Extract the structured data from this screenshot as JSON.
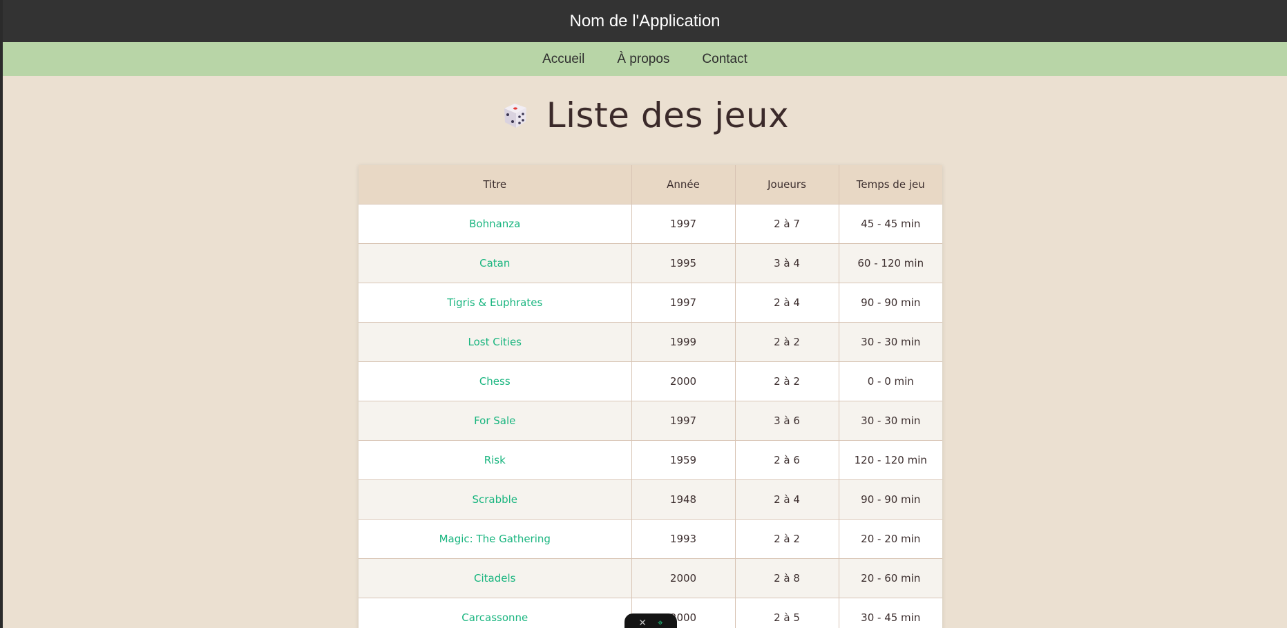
{
  "header": {
    "title": "Nom de l'Application"
  },
  "nav": {
    "items": [
      "Accueil",
      "À propos",
      "Contact"
    ]
  },
  "main": {
    "title": "Liste des jeux",
    "title_icon": "dice-icon"
  },
  "table": {
    "columns": [
      "Titre",
      "Année",
      "Joueurs",
      "Temps de jeu"
    ],
    "rows": [
      {
        "title": "Bohnanza",
        "year": "1997",
        "players": "2 à 7",
        "time": "45 - 45 min"
      },
      {
        "title": "Catan",
        "year": "1995",
        "players": "3 à 4",
        "time": "60 - 120 min"
      },
      {
        "title": "Tigris & Euphrates",
        "year": "1997",
        "players": "2 à 4",
        "time": "90 - 90 min"
      },
      {
        "title": "Lost Cities",
        "year": "1999",
        "players": "2 à 2",
        "time": "30 - 30 min"
      },
      {
        "title": "Chess",
        "year": "2000",
        "players": "2 à 2",
        "time": "0 - 0 min"
      },
      {
        "title": "For Sale",
        "year": "1997",
        "players": "3 à 6",
        "time": "30 - 30 min"
      },
      {
        "title": "Risk",
        "year": "1959",
        "players": "2 à 6",
        "time": "120 - 120 min"
      },
      {
        "title": "Scrabble",
        "year": "1948",
        "players": "2 à 4",
        "time": "90 - 90 min"
      },
      {
        "title": "Magic: The Gathering",
        "year": "1993",
        "players": "2 à 2",
        "time": "20 - 20 min"
      },
      {
        "title": "Citadels",
        "year": "2000",
        "players": "2 à 8",
        "time": "20 - 60 min"
      },
      {
        "title": "Carcassonne",
        "year": "2000",
        "players": "2 à 5",
        "time": "30 - 45 min"
      }
    ]
  },
  "colors": {
    "header_bg": "#333333",
    "nav_bg": "#b8d5a7",
    "page_bg": "#ebe0d1",
    "link": "#19b57f",
    "table_header_bg": "#e8d8c5"
  },
  "toolbar": {
    "icons": [
      "x-icon",
      "target-icon"
    ]
  }
}
